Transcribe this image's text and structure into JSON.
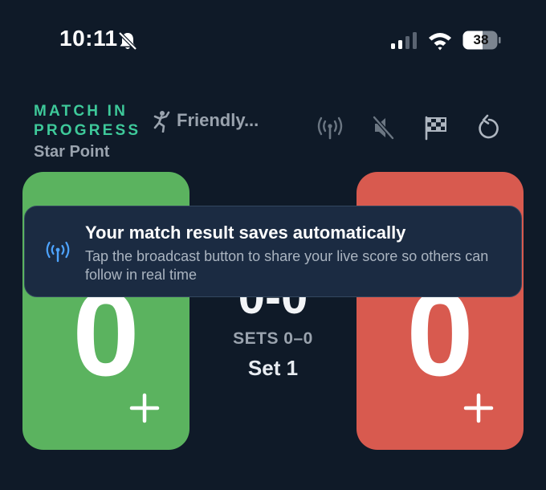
{
  "status_bar": {
    "time": "10:11",
    "battery": "38",
    "icons": [
      "bell-slash-icon",
      "cellular-signal-icon",
      "wifi-icon",
      "battery-icon"
    ]
  },
  "header": {
    "status": "MATCH IN PROGRESS",
    "venue": "Star Point",
    "match_type": "Friendly...",
    "actions": [
      "broadcast-icon",
      "mute-icon",
      "checkered-flag-icon",
      "undo-icon"
    ]
  },
  "scoreboard": {
    "left_score": "0",
    "right_score": "0",
    "game_score": "0-0",
    "sets": "SETS 0–0",
    "set_label": "Set 1",
    "colors": {
      "left": "#5bb35f",
      "right": "#d85a4f",
      "accent": "#3ec99a"
    }
  },
  "toast": {
    "title": "Your match result saves automatically",
    "body": "Tap the broadcast button to share your live score so others can follow in real time",
    "icon": "broadcast-icon"
  }
}
